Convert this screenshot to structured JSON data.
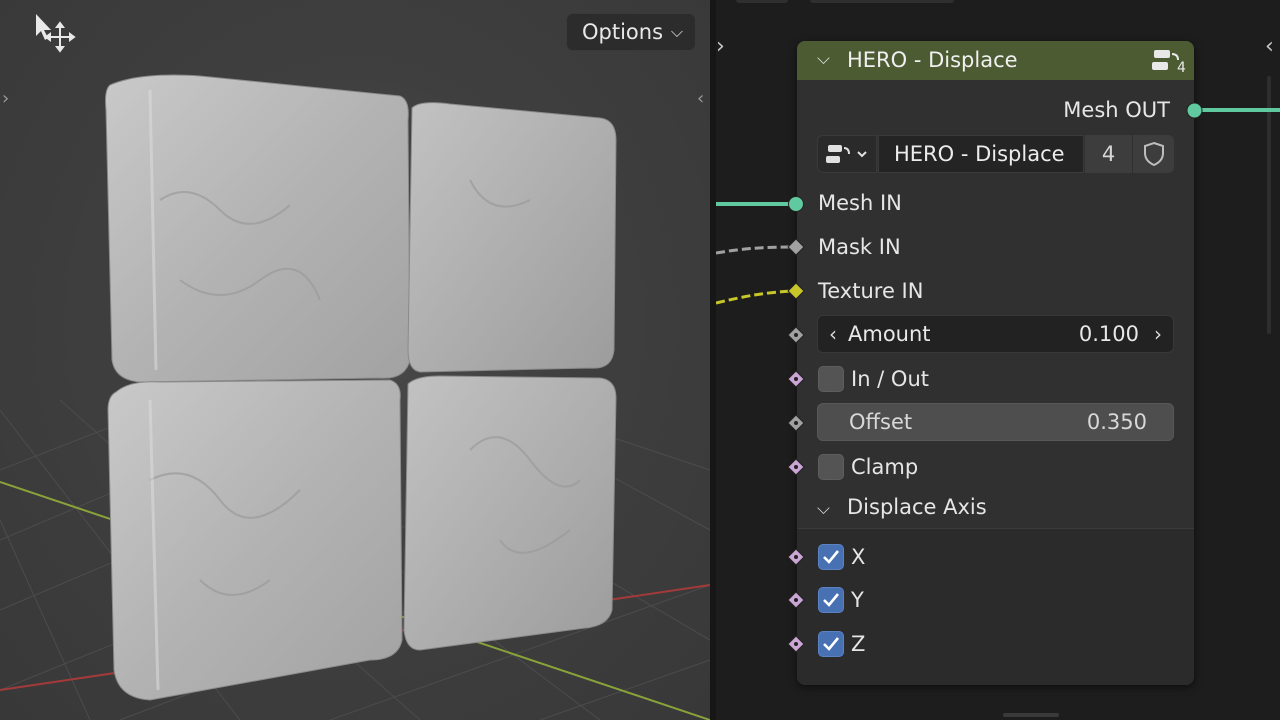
{
  "viewport": {
    "options_label": "Options",
    "tool_icon": "transform-move-cursor-icon",
    "chevron_icon": "chevron-down-icon",
    "left_edge_icon": "chevron-right-icon",
    "right_edge_icon": "chevron-left-icon"
  },
  "node": {
    "title": "HERO - Displace",
    "header_color": "#4c5b32",
    "group_icon": "node-group-icon",
    "group_users": "4",
    "outputs": [
      {
        "label": "Mesh OUT",
        "socket_color": "#61c99f"
      }
    ],
    "group_selector": {
      "icon": "node-tree-dropdown-icon",
      "name": "HERO - Displace",
      "users": "4",
      "fake_user_icon": "shield-icon"
    },
    "inputs": [
      {
        "label": "Mesh IN",
        "socket_color": "#61c99f"
      },
      {
        "label": "Mask IN",
        "socket_color": "#a1a1a1"
      },
      {
        "label": "Texture IN",
        "socket_color": "#c7c729"
      }
    ],
    "amount": {
      "label": "Amount",
      "value": "0.100"
    },
    "in_out": {
      "label": "In / Out",
      "checked": false
    },
    "offset": {
      "label": "Offset",
      "value": "0.350"
    },
    "clamp": {
      "label": "Clamp",
      "checked": false
    },
    "panel": {
      "label": "Displace Axis",
      "axes": [
        {
          "label": "X",
          "checked": true
        },
        {
          "label": "Y",
          "checked": true
        },
        {
          "label": "Z",
          "checked": true
        }
      ]
    },
    "socket_colors": {
      "float": "#a1a1a1",
      "bool": "#cca6d6",
      "geometry": "#61c99f",
      "color": "#c7c729"
    },
    "checkbox_color": "#4771b2"
  }
}
